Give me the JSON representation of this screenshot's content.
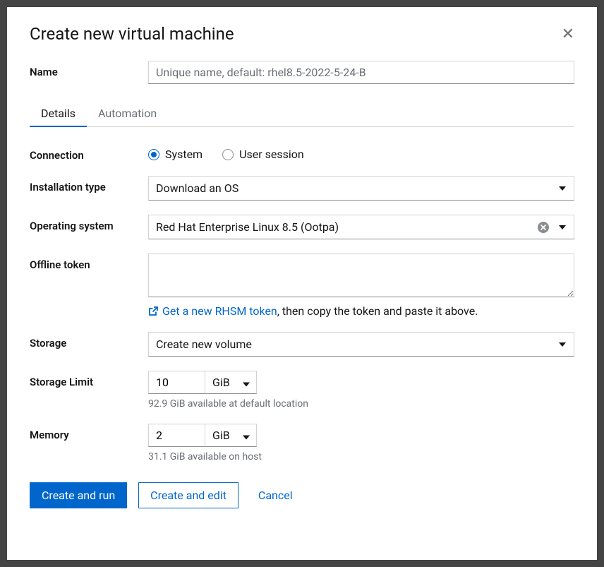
{
  "modal": {
    "title": "Create new virtual machine"
  },
  "form": {
    "name": {
      "label": "Name",
      "placeholder": "Unique name, default: rhel8.5-2022-5-24-B",
      "value": ""
    }
  },
  "tabs": {
    "details": "Details",
    "automation": "Automation"
  },
  "connection": {
    "label": "Connection",
    "system": "System",
    "user_session": "User session"
  },
  "installation_type": {
    "label": "Installation type",
    "value": "Download an OS"
  },
  "operating_system": {
    "label": "Operating system",
    "value": "Red Hat Enterprise Linux 8.5 (Ootpa)"
  },
  "offline_token": {
    "label": "Offline token",
    "link_text": "Get a new RHSM token",
    "hint_rest": ", then copy the token and paste it above."
  },
  "storage": {
    "label": "Storage",
    "value": "Create new volume"
  },
  "storage_limit": {
    "label": "Storage Limit",
    "value": "10",
    "unit": "GiB",
    "help": "92.9 GiB available at default location"
  },
  "memory": {
    "label": "Memory",
    "value": "2",
    "unit": "GiB",
    "help": "31.1 GiB available on host"
  },
  "footer": {
    "create_run": "Create and run",
    "create_edit": "Create and edit",
    "cancel": "Cancel"
  }
}
